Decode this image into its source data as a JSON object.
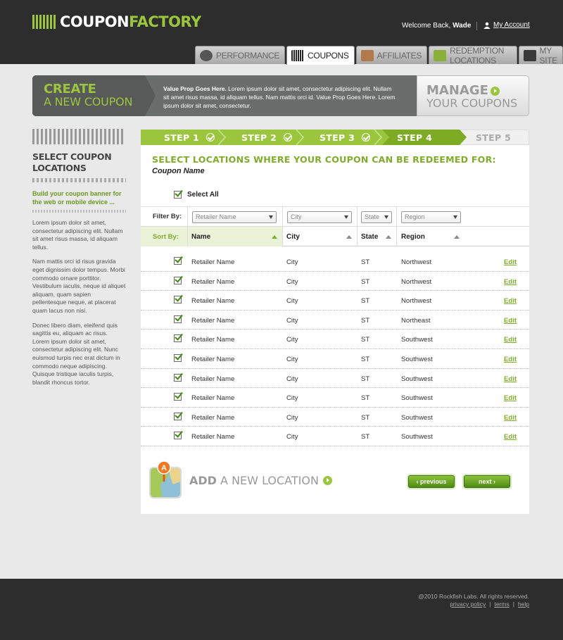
{
  "header": {
    "logo_part1": "COUPON",
    "logo_part2": "FACTORY",
    "welcome_prefix": "Welcome Back,",
    "user_name": "Wade",
    "my_account": "My Account"
  },
  "tabs": [
    {
      "label": "PERFORMANCE",
      "icon": "gauge-icon",
      "color": "#555"
    },
    {
      "label": "COUPONS",
      "icon": "barcode-icon",
      "color": "#333"
    },
    {
      "label": "AFFILIATES",
      "icon": "handshake-icon",
      "color": "#b07a4a"
    },
    {
      "label": "REDEMPTION LOCATIONS",
      "icon": "map-icon",
      "color": "#8bb03a"
    },
    {
      "label": "MY SITE",
      "icon": "laptop-icon",
      "color": "#3a3a3a"
    }
  ],
  "banner": {
    "create_line1": "CREATE",
    "create_line2": "A NEW COUPON",
    "value_prop_title": "Value Prop Goes Here.",
    "value_prop_text": "Lorem ipsum dolor sit amet, consectetur adipiscing elit. Nullam sit amet risus massa, id aliquam tellus. Nam mattis orci id. Value Prop Goes Here. Lorem ipsum dolor sit amet, consectetur.",
    "manage_line1": "MANAGE",
    "manage_line2": "YOUR COUPONS"
  },
  "sidebar": {
    "title_line1": "SELECT COUPON",
    "title_line2": "LOCATIONS",
    "tagline": "Build your coupon banner for the web or mobile device ...",
    "paragraphs": [
      "Lorem ipsum dolor sit amet, consectetur adipiscing elit. Nullam sit amet risus massa, id aliquam tellus.",
      "Nam mattis orci id risus gravida eget dignissim dolor tempus. Morbi commodo ornare porttitor. Vestibulum iaculis, neque id aliquet aliquam, quam sapien pellentesque neque, at placerat quam lacus non nisi.",
      "Donec libero diam, eleifend quis sagittis eu, aliquam ac risus. Lorem ipsum dolor sit amet, consectetur adipiscing elit. Nunc euismod turpis nec erat dictum in commodo neque adipiscing. Quisque tristique iaculis turpis, blandit rhoncus tortor."
    ]
  },
  "steps": [
    {
      "label": "STEP 1",
      "done": true
    },
    {
      "label": "STEP 2",
      "done": true
    },
    {
      "label": "STEP 3",
      "done": true
    },
    {
      "label": "STEP 4",
      "done": false
    },
    {
      "label": "STEP 5",
      "done": false
    }
  ],
  "main": {
    "title": "SELECT LOCATIONS WHERE YOUR COUPON CAN BE REDEEMED FOR:",
    "subtitle": "Coupon Name",
    "select_all": "Select All",
    "filter_label": "Filter By:",
    "sort_label": "Sort By:",
    "filters": {
      "name": "Retailer Name",
      "city": "City",
      "state": "State",
      "region": "Region"
    },
    "columns": [
      "Name",
      "City",
      "State",
      "Region"
    ],
    "rows": [
      {
        "name": "Retailer Name",
        "city": "City",
        "state": "ST",
        "region": "Northwest",
        "action": "Edit"
      },
      {
        "name": "Retailer Name",
        "city": "City",
        "state": "ST",
        "region": "Northwest",
        "action": "Edit"
      },
      {
        "name": "Retailer Name",
        "city": "City",
        "state": "ST",
        "region": "Northwest",
        "action": "Edit"
      },
      {
        "name": "Retailer Name",
        "city": "City",
        "state": "ST",
        "region": "Northeast",
        "action": "Edit"
      },
      {
        "name": "Retailer Name",
        "city": "City",
        "state": "ST",
        "region": "Southwest",
        "action": "Edit"
      },
      {
        "name": "Retailer Name",
        "city": "City",
        "state": "ST",
        "region": "Southwest",
        "action": "Edit"
      },
      {
        "name": "Retailer Name",
        "city": "City",
        "state": "ST",
        "region": "Southwest",
        "action": "Edit"
      },
      {
        "name": "Retailer Name",
        "city": "City",
        "state": "ST",
        "region": "Southwest",
        "action": "Edit"
      },
      {
        "name": "Retailer Name",
        "city": "City",
        "state": "ST",
        "region": "Southwest",
        "action": "Edit"
      },
      {
        "name": "Retailer Name",
        "city": "City",
        "state": "ST",
        "region": "Southwest",
        "action": "Edit"
      }
    ],
    "add_location_bold": "ADD",
    "add_location_rest": "A NEW LOCATION",
    "previous": "‹ previous",
    "next": "next ›"
  },
  "footer": {
    "copyright": "@2010 Rockfish Labs. All rights reserved.",
    "links": [
      "privacy policy",
      "terms",
      "help"
    ]
  },
  "colors": {
    "accent": "#9bc53d",
    "header_bg": "#2d2d2d",
    "link_green": "#7fac2a"
  }
}
